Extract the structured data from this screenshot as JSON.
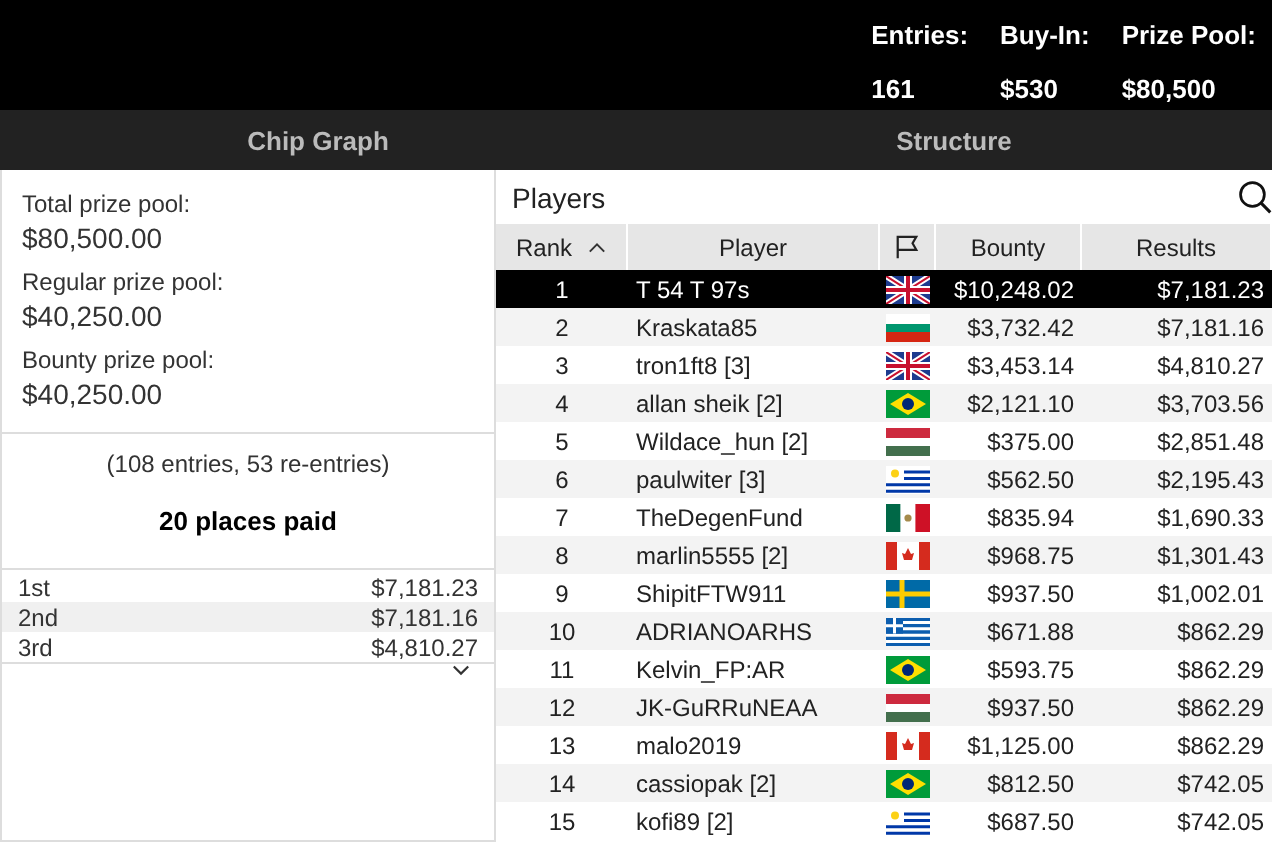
{
  "header": {
    "stats": [
      {
        "label": "Entries:",
        "value": "161"
      },
      {
        "label": "Buy-In:",
        "value": "$530"
      },
      {
        "label": "Prize Pool:",
        "value": "$80,500"
      }
    ]
  },
  "tabs": [
    {
      "label": "Chip Graph",
      "selected": false
    },
    {
      "label": "Structure",
      "selected": false
    }
  ],
  "prize_pools": [
    {
      "label": "Total prize pool:",
      "value": "$80,500.00"
    },
    {
      "label": "Regular prize pool:",
      "value": "$40,250.00"
    },
    {
      "label": "Bounty prize pool:",
      "value": "$40,250.00"
    }
  ],
  "entries_note": "(108 entries, 53 re-entries)",
  "places_paid": "20 places paid",
  "payouts": [
    {
      "place": "1st",
      "amount": "$7,181.23"
    },
    {
      "place": "2nd",
      "amount": "$7,181.16"
    },
    {
      "place": "3rd",
      "amount": "$4,810.27"
    }
  ],
  "players_title": "Players",
  "columns": [
    {
      "label": "Rank",
      "kind": "text",
      "sorted": true
    },
    {
      "label": "Player",
      "kind": "text",
      "sorted": false
    },
    {
      "kind": "flag",
      "sorted": false
    },
    {
      "label": "Bounty",
      "kind": "text",
      "sorted": false
    },
    {
      "label": "Results",
      "kind": "text",
      "sorted": false
    }
  ],
  "rows": [
    {
      "rank": "1",
      "player": "T 54 T 97s",
      "flag": {
        "kind": "uk"
      },
      "bounty": "$10,248.02",
      "results": "$7,181.23",
      "selected": true
    },
    {
      "rank": "2",
      "player": "Kraskata85",
      "flag": {
        "kind": "bulgaria"
      },
      "bounty": "$3,732.42",
      "results": "$7,181.16",
      "selected": false
    },
    {
      "rank": "3",
      "player": "tron1ft8 [3]",
      "flag": {
        "kind": "uk"
      },
      "bounty": "$3,453.14",
      "results": "$4,810.27",
      "selected": false
    },
    {
      "rank": "4",
      "player": "allan sheik [2]",
      "flag": {
        "kind": "brazil"
      },
      "bounty": "$2,121.10",
      "results": "$3,703.56",
      "selected": false
    },
    {
      "rank": "5",
      "player": "Wildace_hun [2]",
      "flag": {
        "kind": "hungary"
      },
      "bounty": "$375.00",
      "results": "$2,851.48",
      "selected": false
    },
    {
      "rank": "6",
      "player": "paulwiter [3]",
      "flag": {
        "kind": "uruguay"
      },
      "bounty": "$562.50",
      "results": "$2,195.43",
      "selected": false
    },
    {
      "rank": "7",
      "player": "TheDegenFund",
      "flag": {
        "kind": "mexico"
      },
      "bounty": "$835.94",
      "results": "$1,690.33",
      "selected": false
    },
    {
      "rank": "8",
      "player": "marlin5555 [2]",
      "flag": {
        "kind": "canada"
      },
      "bounty": "$968.75",
      "results": "$1,301.43",
      "selected": false
    },
    {
      "rank": "9",
      "player": "ShipitFTW911",
      "flag": {
        "kind": "sweden"
      },
      "bounty": "$937.50",
      "results": "$1,002.01",
      "selected": false
    },
    {
      "rank": "10",
      "player": "ADRIANOARHS",
      "flag": {
        "kind": "greece"
      },
      "bounty": "$671.88",
      "results": "$862.29",
      "selected": false
    },
    {
      "rank": "11",
      "player": "Kelvin_FP:AR",
      "flag": {
        "kind": "brazil"
      },
      "bounty": "$593.75",
      "results": "$862.29",
      "selected": false
    },
    {
      "rank": "12",
      "player": "JK-GuRRuNEAA",
      "flag": {
        "kind": "hungary"
      },
      "bounty": "$937.50",
      "results": "$862.29",
      "selected": false
    },
    {
      "rank": "13",
      "player": "malo2019",
      "flag": {
        "kind": "canada"
      },
      "bounty": "$1,125.00",
      "results": "$862.29",
      "selected": false
    },
    {
      "rank": "14",
      "player": "cassiopak [2]",
      "flag": {
        "kind": "brazil"
      },
      "bounty": "$812.50",
      "results": "$742.05",
      "selected": false
    },
    {
      "rank": "15",
      "player": "kofi89 [2]",
      "flag": {
        "kind": "uruguay"
      },
      "bounty": "$687.50",
      "results": "$742.05",
      "selected": false
    }
  ]
}
